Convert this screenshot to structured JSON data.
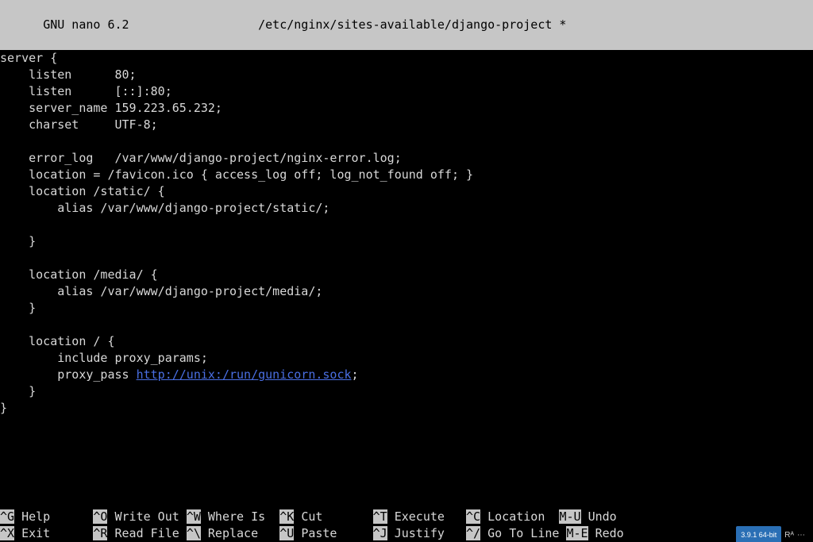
{
  "titlebar": {
    "app": "GNU nano 6.2",
    "filepath": "/etc/nginx/sites-available/django-project *"
  },
  "file": {
    "lines": [
      "server {",
      "    listen      80;",
      "    listen      [::]:80;",
      "    server_name 159.223.65.232;",
      "    charset     UTF-8;",
      "",
      "    error_log   /var/www/django-project/nginx-error.log;",
      "    location = /favicon.ico { access_log off; log_not_found off; }",
      "    location /static/ {",
      "        alias /var/www/django-project/static/;",
      "",
      "    }",
      "",
      "    location /media/ {",
      "        alias /var/www/django-project/media/;",
      "    }",
      "",
      "    location / {",
      "        include proxy_params;",
      "        proxy_pass "
    ],
    "proxy_url": "http://unix:/run/gunicorn.sock",
    "lines_after": [
      ";",
      "    }",
      "}"
    ]
  },
  "shortcuts": {
    "row1": [
      {
        "key": "^G",
        "label": "Help"
      },
      {
        "key": "^O",
        "label": "Write Out"
      },
      {
        "key": "^W",
        "label": "Where Is"
      },
      {
        "key": "^K",
        "label": "Cut"
      },
      {
        "key": "^T",
        "label": "Execute"
      },
      {
        "key": "^C",
        "label": "Location"
      },
      {
        "key": "M-U",
        "label": "Undo"
      }
    ],
    "row2": [
      {
        "key": "^X",
        "label": "Exit"
      },
      {
        "key": "^R",
        "label": "Read File"
      },
      {
        "key": "^\\",
        "label": "Replace"
      },
      {
        "key": "^U",
        "label": "Paste"
      },
      {
        "key": "^J",
        "label": "Justify"
      },
      {
        "key": "^/",
        "label": "Go To Line"
      },
      {
        "key": "M-E",
        "label": "Redo"
      }
    ]
  },
  "taskbar": {
    "python_version": "3.9.1 64-bit",
    "lang_hint": "Rᴬ"
  }
}
